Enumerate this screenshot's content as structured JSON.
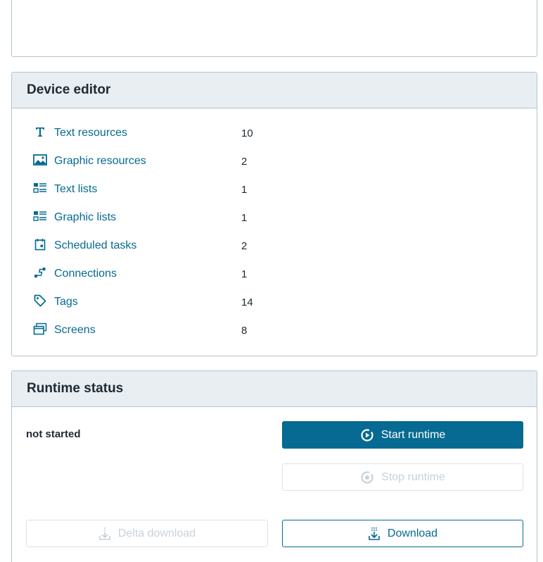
{
  "device_editor": {
    "title": "Device editor",
    "items": [
      {
        "icon": "text-resource-icon",
        "label": "Text resources",
        "count": "10"
      },
      {
        "icon": "image-icon",
        "label": "Graphic resources",
        "count": "2"
      },
      {
        "icon": "text-list-icon",
        "label": "Text lists",
        "count": "1"
      },
      {
        "icon": "graphic-list-icon",
        "label": "Graphic lists",
        "count": "1"
      },
      {
        "icon": "calendar-icon",
        "label": "Scheduled tasks",
        "count": "2"
      },
      {
        "icon": "connection-icon",
        "label": "Connections",
        "count": "1"
      },
      {
        "icon": "tag-icon",
        "label": "Tags",
        "count": "14"
      },
      {
        "icon": "screens-icon",
        "label": "Screens",
        "count": "8"
      }
    ]
  },
  "runtime_status": {
    "title": "Runtime status",
    "status": "not started",
    "start_label": "Start runtime",
    "stop_label": "Stop runtime",
    "delta_download_label": "Delta download",
    "download_label": "Download"
  },
  "colors": {
    "accent": "#066a92",
    "header_bg": "#e9eef2",
    "disabled_text": "#c7d2da"
  }
}
